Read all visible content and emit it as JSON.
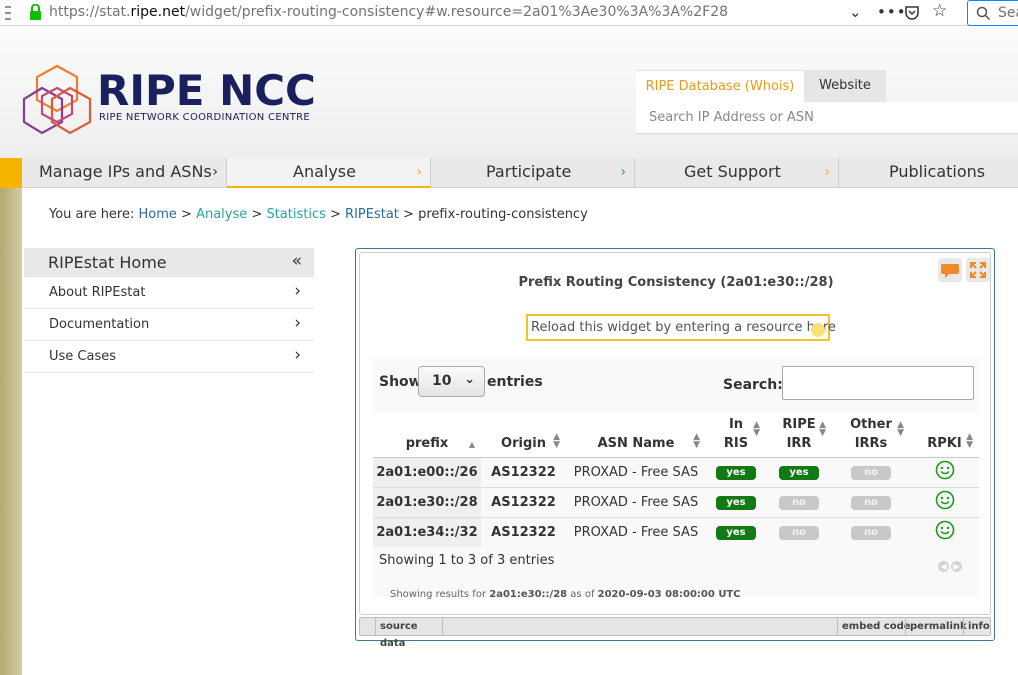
{
  "browser": {
    "url_prefix": "https://stat.",
    "url_domain": "ripe.net",
    "url_rest": "/widget/prefix-routing-consistency#w.resource=2a01%3Ae30%3A%3A%2F28",
    "search_placeholder": "Sea"
  },
  "header": {
    "brand": "RIPE NCC",
    "brand_sub": "RIPE NETWORK COORDINATION CENTRE",
    "tabs": [
      {
        "label": "RIPE Database (Whois)"
      },
      {
        "label": "Website"
      }
    ],
    "search_placeholder": "Search IP Address or ASN"
  },
  "nav": {
    "items": [
      {
        "label": "Manage IPs and ASNs"
      },
      {
        "label": "Analyse"
      },
      {
        "label": "Participate"
      },
      {
        "label": "Get Support"
      },
      {
        "label": "Publications"
      }
    ]
  },
  "breadcrumb": {
    "prefix": "You are here: ",
    "home": "Home",
    "analyse": "Analyse",
    "statistics": "Statistics",
    "ripestat": "RIPEstat",
    "current": "prefix-routing-consistency",
    "sep": " > "
  },
  "sidebar": {
    "title": "RIPEstat Home",
    "items": [
      {
        "label": "About RIPEstat"
      },
      {
        "label": "Documentation"
      },
      {
        "label": "Use Cases"
      }
    ]
  },
  "widget": {
    "title": "Prefix Routing Consistency (2a01:e30::/28)",
    "reload_text": "Reload this widget by entering a resource here",
    "show_label": "Show",
    "entries_value": "10",
    "entries_label": "entries",
    "search_label": "Search:",
    "columns": [
      {
        "l1": "",
        "l2": "prefix"
      },
      {
        "l1": "",
        "l2": "Origin"
      },
      {
        "l1": "",
        "l2": "ASN Name"
      },
      {
        "l1": "In",
        "l2": "RIS"
      },
      {
        "l1": "RIPE",
        "l2": "IRR"
      },
      {
        "l1": "Other",
        "l2": "IRRs"
      },
      {
        "l1": "",
        "l2": "RPKI"
      }
    ],
    "rows": [
      {
        "prefix": "2a01:e00::/26",
        "origin": "AS12322",
        "asn_name": "PROXAD - Free SAS",
        "in_ris": "yes",
        "ripe_irr": "yes",
        "other_irrs": "no",
        "rpki": "valid"
      },
      {
        "prefix": "2a01:e30::/28",
        "origin": "AS12322",
        "asn_name": "PROXAD - Free SAS",
        "in_ris": "yes",
        "ripe_irr": "no",
        "other_irrs": "no",
        "rpki": "valid"
      },
      {
        "prefix": "2a01:e34::/32",
        "origin": "AS12322",
        "asn_name": "PROXAD - Free SAS",
        "in_ris": "yes",
        "ripe_irr": "no",
        "other_irrs": "no",
        "rpki": "valid"
      }
    ],
    "showing_text": "Showing 1 to 3 of 3 entries",
    "results_prefix": "Showing results for ",
    "results_resource": "2a01:e30::/28",
    "results_mid": " as of ",
    "results_time": "2020-09-03 08:00:00 UTC",
    "footer": {
      "source_data": "source data",
      "embed_code": "embed code",
      "permalink": "permalink",
      "info": "info"
    }
  },
  "colors": {
    "accent_gold": "#f5b400",
    "brand_navy": "#1a1f5e",
    "yes_green": "#127a12",
    "no_gray": "#c8c8c8",
    "link_blue": "#2b6aa0",
    "link_teal": "#27a3a3"
  },
  "icons": [
    "lock-icon",
    "search-icon",
    "chevron-down-icon",
    "more-icon",
    "pocket-icon",
    "star-icon",
    "chevron-right-icon",
    "collapse-icon",
    "chat-icon",
    "expand-icon",
    "sort-icon",
    "smiley-icon",
    "prev-page-icon",
    "next-page-icon"
  ]
}
